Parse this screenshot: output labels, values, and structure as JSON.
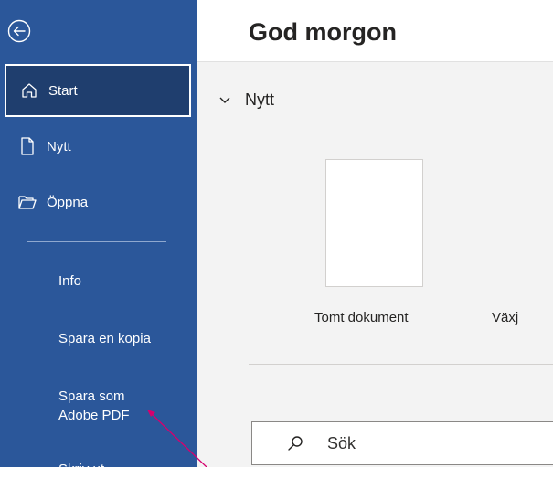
{
  "sidebar": {
    "items": [
      {
        "label": "Start",
        "icon": "home-icon"
      },
      {
        "label": "Nytt",
        "icon": "new-document-icon"
      },
      {
        "label": "Öppna",
        "icon": "folder-open-icon"
      }
    ],
    "text_items": [
      {
        "label": "Info"
      },
      {
        "label": "Spara en kopia"
      },
      {
        "label": "Spara som\nAdobe PDF"
      },
      {
        "label": "Skriv ut"
      }
    ]
  },
  "main": {
    "greeting": "God morgon",
    "section_title": "Nytt",
    "templates": [
      {
        "label": "Tomt dokument"
      },
      {
        "label": "Växj"
      }
    ],
    "search": {
      "placeholder": "Sök"
    }
  },
  "colors": {
    "sidebar_bg": "#2b579a",
    "selected_bg": "#1f3e6e",
    "annotation_arrow": "#d6006e"
  }
}
